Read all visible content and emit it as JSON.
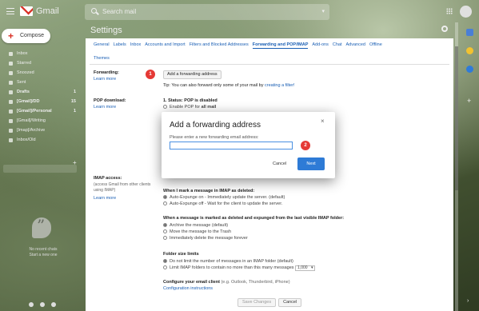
{
  "app": {
    "name": "Gmail"
  },
  "search": {
    "text": "Search mail"
  },
  "compose": {
    "label": "Compose"
  },
  "sidebar": {
    "items": [
      {
        "label": "Inbox",
        "count": ""
      },
      {
        "label": "Starred",
        "count": ""
      },
      {
        "label": "Snoozed",
        "count": ""
      },
      {
        "label": "Sent",
        "count": ""
      },
      {
        "label": "Drafts",
        "count": "1"
      },
      {
        "label": "[Gmail]/DD",
        "count": "15"
      },
      {
        "label": "[Gmail]/Personal",
        "count": "1"
      },
      {
        "label": "[Gmail]/Writing",
        "count": ""
      },
      {
        "label": "[Imap]/Archive",
        "count": ""
      },
      {
        "label": "Inbox/Old",
        "count": ""
      }
    ],
    "no_chats": "No recent chats",
    "start_new": "Start a new one"
  },
  "settings": {
    "title": "Settings",
    "tabs": [
      "General",
      "Labels",
      "Inbox",
      "Accounts and Import",
      "Filters and Blocked Addresses",
      "Forwarding and POP/IMAP",
      "Add-ons",
      "Chat",
      "Advanced",
      "Offline"
    ],
    "active_tab": "Forwarding and POP/IMAP",
    "themes_tab": "Themes",
    "forwarding": {
      "label": "Forwarding:",
      "learn_more": "Learn more",
      "button": "Add a forwarding address",
      "tip": "Tip: You can also forward only some of your mail by",
      "tip_link": "creating a filter!"
    },
    "pop": {
      "label": "POP download:",
      "learn_more": "Learn more",
      "status": "1. Status: POP is disabled",
      "enable_all_prefix": "Enable POP for",
      "enable_all_bold": "all mail"
    },
    "imap": {
      "label": "IMAP access:",
      "sub": "(access Gmail from other clients using IMAP)",
      "learn_more": "Learn more"
    },
    "deleted": {
      "title": "When I mark a message in IMAP as deleted:",
      "opt1": "Auto-Expunge on - Immediately update the server. (default)",
      "opt2": "Auto-Expunge off - Wait for the client to update the server."
    },
    "expunged": {
      "title": "When a message is marked as deleted and expunged from the last visible IMAP folder:",
      "opt1": "Archive the message (default)",
      "opt2": "Move the message to the Trash",
      "opt3": "Immediately delete the message forever"
    },
    "folder_size": {
      "title": "Folder size limits",
      "opt1": "Do not limit the number of messages in an IMAP folder (default)",
      "opt2": "Limit IMAP folders to contain no more than this many messages",
      "limit_value": "1,000"
    },
    "client": {
      "title": "Configure your email client",
      "title_suffix": "(e.g. Outlook, Thunderbird, iPhone)",
      "link": "Configuration instructions"
    },
    "save_label": "Save Changes",
    "cancel_label": "Cancel"
  },
  "dialog": {
    "title": "Add a forwarding address",
    "close": "×",
    "label": "Please enter a new forwarding email address:",
    "input_value": "",
    "cancel": "Cancel",
    "next": "Next"
  },
  "badges": {
    "one": "1",
    "two": "2"
  },
  "colors": {
    "accent": "#2e7bd6",
    "badge": "#e53935",
    "link": "#1a5fb4",
    "gmail_red": "#d93025"
  }
}
